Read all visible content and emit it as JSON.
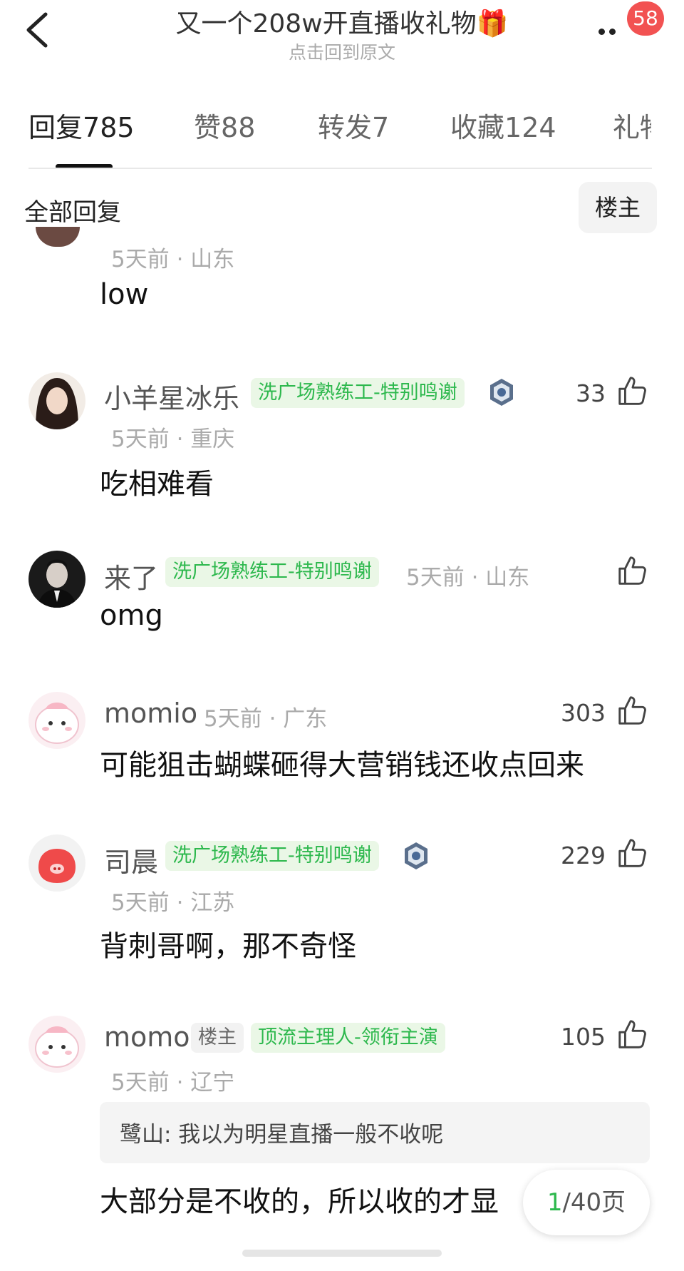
{
  "header": {
    "title": "又一个208w开直播收礼物🎁",
    "subtitle": "点击回到原文",
    "notification_count": "58"
  },
  "tabs": [
    {
      "label": "回复",
      "count": "785"
    },
    {
      "label": "赞",
      "count": "88"
    },
    {
      "label": "转发",
      "count": "7"
    },
    {
      "label": "收藏",
      "count": "124"
    },
    {
      "label": "礼物",
      "count": ""
    }
  ],
  "filter": {
    "label": "全部回复",
    "owner_button": "楼主"
  },
  "comments": [
    {
      "meta": "5天前 · 山东",
      "text": "low"
    },
    {
      "name": "小羊星冰乐",
      "tag": "洗广场熟练工-特别鸣谢",
      "likes": "33",
      "meta": "5天前 · 重庆",
      "text": "吃相难看"
    },
    {
      "name": "来了",
      "tag": "洗广场熟练工-特别鸣谢",
      "likes": "",
      "meta": "5天前 · 山东",
      "text": "omg"
    },
    {
      "name": "momio",
      "likes": "303",
      "meta": "5天前 · 广东",
      "text": "可能狙击蝴蝶砸得大营销钱还收点回来"
    },
    {
      "name": "司晨",
      "tag": "洗广场熟练工-特别鸣谢",
      "likes": "229",
      "meta": "5天前 · 江苏",
      "text": "背刺哥啊，那不奇怪"
    },
    {
      "name": "momo",
      "owner_tag": "楼主",
      "tag": "顶流主理人-领衔主演",
      "likes": "105",
      "meta": "5天前 · 辽宁",
      "quote": "鹭山: 我以为明星直播一般不收呢",
      "text": "大部分是不收的，所以收的才显"
    }
  ],
  "pager": {
    "current": "1",
    "total": "/40页"
  },
  "colors": {
    "accent_green": "#2db84d",
    "badge_red": "#f25252"
  }
}
